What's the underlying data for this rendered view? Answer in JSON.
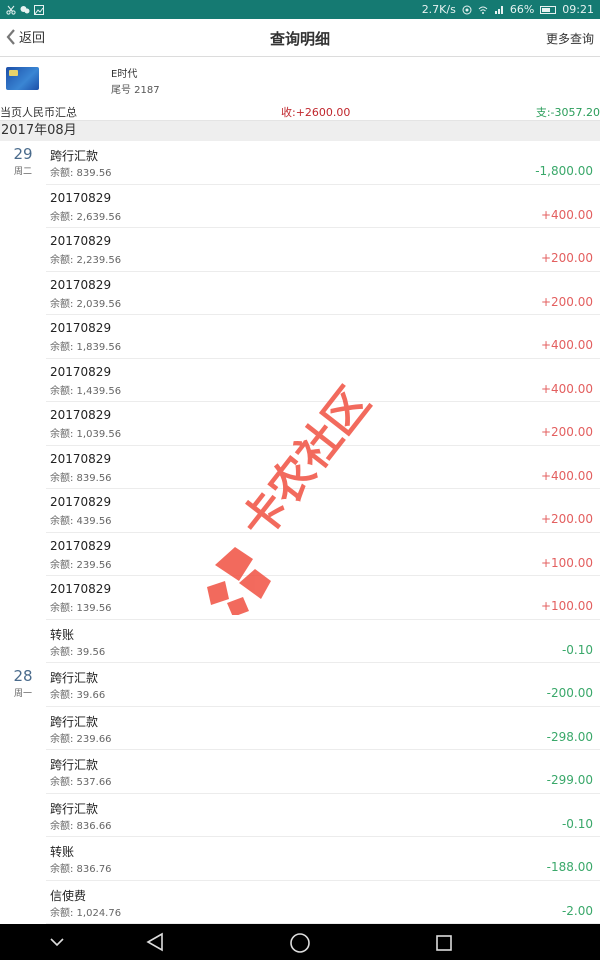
{
  "status_bar": {
    "speed": "2.7K/s",
    "battery": "66%",
    "time": "09:21",
    "battery_level": 0.66
  },
  "nav": {
    "back_label": "返回",
    "title": "查询明细",
    "more_label": "更多查询"
  },
  "account": {
    "name": "E时代",
    "number": "尾号 2187"
  },
  "summary": {
    "label": "当页人民币汇总",
    "income": "收:+2600.00",
    "expense": "支:-3057.20"
  },
  "month": "2017年08月",
  "transactions": [
    {
      "day": "29",
      "weekday": "周二",
      "title": "跨行汇款",
      "balance": "余额: 839.56",
      "amount": "-1,800.00",
      "type": "neg"
    },
    {
      "title": "20170829",
      "balance": "余额: 2,639.56",
      "amount": "+400.00",
      "type": "pos"
    },
    {
      "title": "20170829",
      "balance": "余额: 2,239.56",
      "amount": "+200.00",
      "type": "pos"
    },
    {
      "title": "20170829",
      "balance": "余额: 2,039.56",
      "amount": "+200.00",
      "type": "pos"
    },
    {
      "title": "20170829",
      "balance": "余额: 1,839.56",
      "amount": "+400.00",
      "type": "pos"
    },
    {
      "title": "20170829",
      "balance": "余额: 1,439.56",
      "amount": "+400.00",
      "type": "pos"
    },
    {
      "title": "20170829",
      "balance": "余额: 1,039.56",
      "amount": "+200.00",
      "type": "pos"
    },
    {
      "title": "20170829",
      "balance": "余额: 839.56",
      "amount": "+400.00",
      "type": "pos"
    },
    {
      "title": "20170829",
      "balance": "余额: 439.56",
      "amount": "+200.00",
      "type": "pos"
    },
    {
      "title": "20170829",
      "balance": "余额: 239.56",
      "amount": "+100.00",
      "type": "pos"
    },
    {
      "title": "20170829",
      "balance": "余额: 139.56",
      "amount": "+100.00",
      "type": "pos"
    },
    {
      "title": "转账",
      "balance": "余额: 39.56",
      "amount": "-0.10",
      "type": "neg"
    },
    {
      "day": "28",
      "weekday": "周一",
      "title": "跨行汇款",
      "balance": "余额: 39.66",
      "amount": "-200.00",
      "type": "neg"
    },
    {
      "title": "跨行汇款",
      "balance": "余额: 239.66",
      "amount": "-298.00",
      "type": "neg"
    },
    {
      "title": "跨行汇款",
      "balance": "余额: 537.66",
      "amount": "-299.00",
      "type": "neg"
    },
    {
      "title": "跨行汇款",
      "balance": "余额: 836.66",
      "amount": "-0.10",
      "type": "neg"
    },
    {
      "title": "转账",
      "balance": "余额: 836.76",
      "amount": "-188.00",
      "type": "neg"
    },
    {
      "title": "信使费",
      "balance": "余额: 1,024.76",
      "amount": "-2.00",
      "type": "neg"
    }
  ],
  "watermark": "卡农社区",
  "colors": {
    "status_bar": "#157a72",
    "income": "#c0272d",
    "expense": "#2a9d5a",
    "positive_amount": "#e35f5f",
    "negative_amount": "#3aa86a",
    "day_number": "#4a6b8c",
    "watermark": "#f04a3a"
  }
}
